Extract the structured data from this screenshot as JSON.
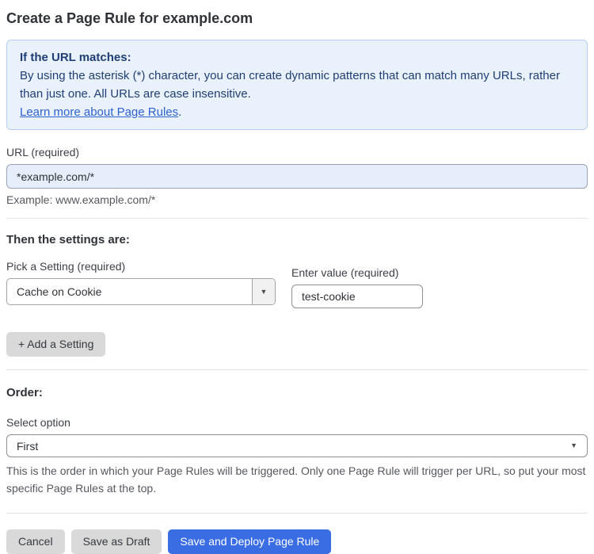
{
  "page": {
    "title": "Create a Page Rule for example.com"
  },
  "info_box": {
    "heading": "If the URL matches:",
    "body": "By using the asterisk (*) character, you can create dynamic patterns that can match many URLs, rather than just one. All URLs are case insensitive.",
    "link_label": "Learn more about Page Rules",
    "link_suffix": "."
  },
  "url_field": {
    "label": "URL (required)",
    "value": "*example.com/*",
    "example": "Example: www.example.com/*"
  },
  "settings_section": {
    "heading": "Then the settings are:",
    "setting_label": "Pick a Setting (required)",
    "setting_value": "Cache on Cookie",
    "value_label": "Enter value (required)",
    "value_value": "test-cookie",
    "add_setting_label": "+ Add a Setting"
  },
  "order_section": {
    "heading": "Order:",
    "select_label": "Select option",
    "select_value": "First",
    "help_text": "This is the order in which your Page Rules will be triggered. Only one Page Rule will trigger per URL, so put your most specific Page Rules at the top."
  },
  "footer": {
    "cancel_label": "Cancel",
    "save_draft_label": "Save as Draft",
    "save_deploy_label": "Save and Deploy Page Rule"
  },
  "icons": {
    "dropdown_caret": "▼"
  },
  "colors": {
    "info_box_bg": "#e9f1fc",
    "info_box_border": "#b6cef2",
    "info_text": "#1f3e75",
    "link": "#2f62cf",
    "url_input_bg": "#e7eefb",
    "primary_button_bg": "#3a6ce4",
    "secondary_button_bg": "#d9d9d9"
  }
}
